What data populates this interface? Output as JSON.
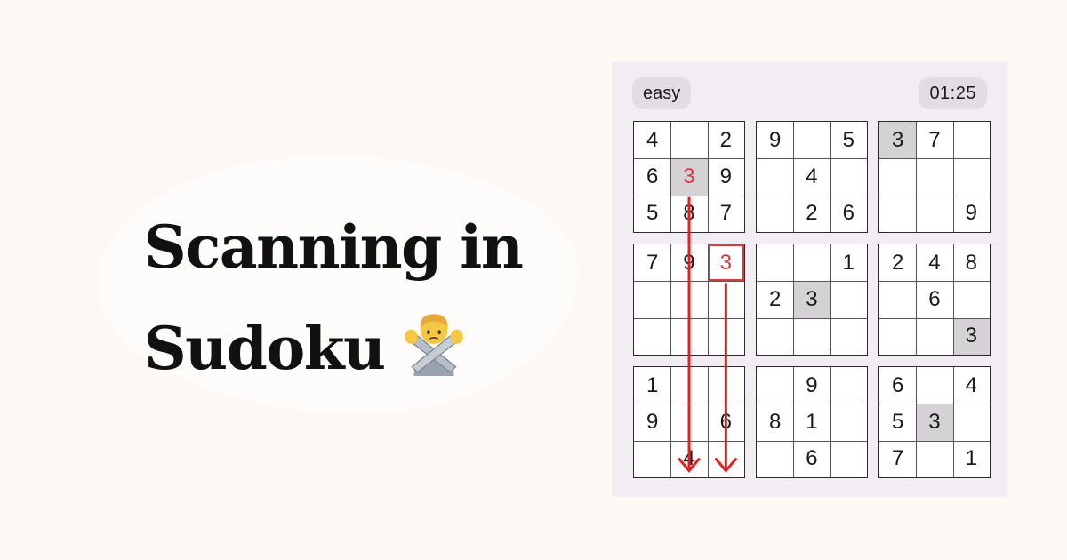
{
  "headline": {
    "line1": "Scanning in",
    "line2": "Sudoku"
  },
  "emoji_icon": "person-gesturing-no-emoji",
  "game": {
    "difficulty": "easy",
    "timer": "01:25",
    "colors": {
      "error": "#d9393f",
      "highlight": "#d4d2d4",
      "arrow": "#e81d1d"
    },
    "grid": [
      [
        "4",
        "",
        "2",
        "9",
        "",
        "5",
        "3",
        "7",
        ""
      ],
      [
        "6",
        "3",
        "9",
        "",
        "4",
        "",
        "",
        "",
        ""
      ],
      [
        "5",
        "8",
        "7",
        "",
        "2",
        "6",
        "",
        "",
        "9"
      ],
      [
        "7",
        "9",
        "3",
        "",
        "",
        "1",
        "2",
        "4",
        "8"
      ],
      [
        "",
        "",
        "",
        "2",
        "3",
        "",
        "",
        "6",
        ""
      ],
      [
        "",
        "",
        "",
        "",
        "",
        "",
        "",
        "",
        "3"
      ],
      [
        "1",
        "",
        "",
        "",
        "9",
        "",
        "6",
        "",
        "4"
      ],
      [
        "9",
        "",
        "6",
        "8",
        "1",
        "",
        "5",
        "3",
        ""
      ],
      [
        "",
        "4",
        "",
        "",
        "6",
        "",
        "7",
        "",
        "1"
      ]
    ],
    "shaded": [
      [
        0,
        6
      ],
      [
        1,
        1
      ],
      [
        4,
        4
      ],
      [
        5,
        8
      ],
      [
        7,
        7
      ]
    ],
    "errors": [
      [
        1,
        1
      ],
      [
        3,
        2
      ]
    ],
    "outlined": [
      [
        3,
        2
      ]
    ],
    "scan_arrows": [
      {
        "column": 1,
        "from_row": 2,
        "to_row": 8
      },
      {
        "column": 2,
        "from_row": 4,
        "to_row": 8
      }
    ]
  }
}
